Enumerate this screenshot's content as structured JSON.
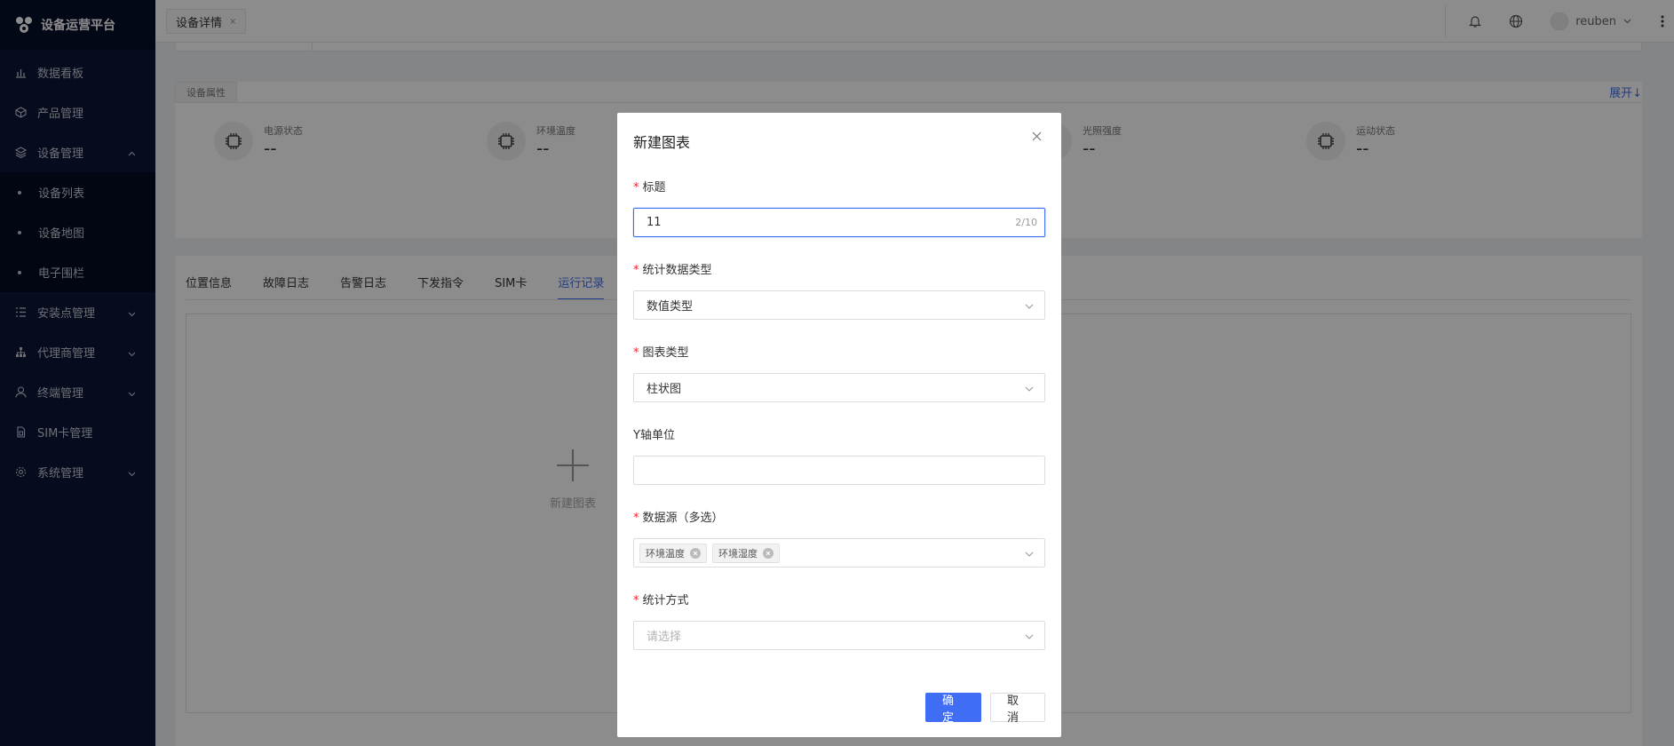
{
  "app": {
    "title": "设备运营平台"
  },
  "sidebar": {
    "items": [
      {
        "label": "数据看板",
        "icon": "chart-bar-icon"
      },
      {
        "label": "产品管理",
        "icon": "cube-icon"
      },
      {
        "label": "设备管理",
        "icon": "layers-icon",
        "expanded": true,
        "children": [
          "设备列表",
          "设备地图",
          "电子围栏"
        ]
      },
      {
        "label": "安装点管理",
        "icon": "list-icon",
        "expanded": false
      },
      {
        "label": "代理商管理",
        "icon": "org-icon",
        "expanded": false
      },
      {
        "label": "终端管理",
        "icon": "user-icon",
        "expanded": false
      },
      {
        "label": "SIM卡管理",
        "icon": "sim-icon"
      },
      {
        "label": "系统管理",
        "icon": "gear-icon",
        "expanded": false
      }
    ]
  },
  "header": {
    "tab_label": "设备详情",
    "tab_close": "×",
    "user_name": "reuben"
  },
  "properties": {
    "section_label": "设备属性",
    "expand_label": "展开↓",
    "items": [
      {
        "name": "电源状态",
        "value": "--"
      },
      {
        "name": "环境温度",
        "value": "--"
      },
      {
        "name": "",
        "value": ""
      },
      {
        "name": "光照强度",
        "value": "--"
      },
      {
        "name": "运动状态",
        "value": "--"
      }
    ]
  },
  "detail_tabs": {
    "tabs": [
      "位置信息",
      "故障日志",
      "告警日志",
      "下发指令",
      "SIM卡",
      "运行记录"
    ],
    "active_index": 5,
    "new_chart_label": "新建图表"
  },
  "modal": {
    "title": "新建图表",
    "fields": {
      "title": {
        "label": "标题",
        "required": true,
        "value": "11",
        "counter": "2/10"
      },
      "data_type": {
        "label": "统计数据类型",
        "required": true,
        "value": "数值类型"
      },
      "chart_type": {
        "label": "图表类型",
        "required": true,
        "value": "柱状图"
      },
      "y_unit": {
        "label": "Y轴单位",
        "required": false,
        "value": ""
      },
      "data_source": {
        "label": "数据源（多选）",
        "required": true,
        "tags": [
          "环境温度",
          "环境湿度"
        ]
      },
      "stat_method": {
        "label": "统计方式",
        "required": true,
        "placeholder": "请选择"
      }
    },
    "confirm_label": "确定",
    "cancel_label": "取消"
  },
  "colors": {
    "primary": "#3f6ef5",
    "sidebar_bg": "#0b1437",
    "required": "#f5222d"
  }
}
